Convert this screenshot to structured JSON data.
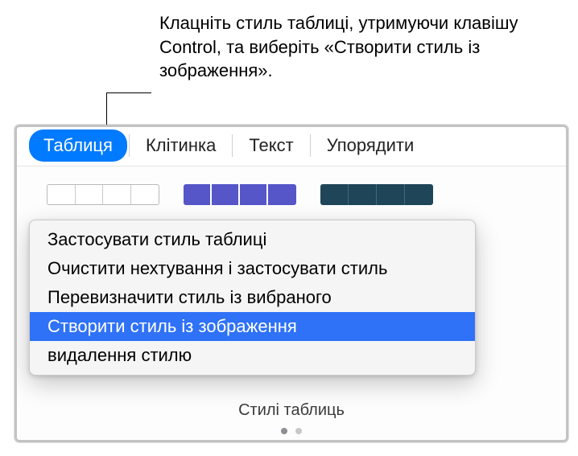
{
  "annotation": {
    "text": "Клацніть стиль таблиці, утримуючи клавішу Control, та виберіть «Створити стиль із зображення»."
  },
  "tabs": {
    "table": "Таблиця",
    "cell": "Клітинка",
    "text": "Текст",
    "arrange": "Упорядити"
  },
  "context_menu": {
    "items": [
      "Застосувати стиль таблиці",
      "Очистити нехтування і застосувати стиль",
      "Перевизначити стиль із вибраного",
      "Створити стиль із зображення",
      "видалення стилю"
    ],
    "highlighted_index": 3
  },
  "styles_section": {
    "label": "Стилі таблиць"
  }
}
